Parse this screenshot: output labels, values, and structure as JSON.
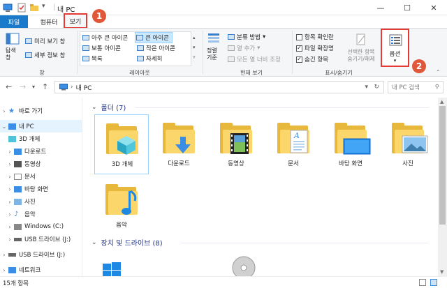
{
  "titlebar": {
    "title": "내 PC",
    "minimize": "—",
    "maximize": "☐",
    "close": "✕"
  },
  "tabs": {
    "file": "파일",
    "computer": "컴퓨터",
    "view": "보기"
  },
  "annotations": {
    "badge1": "1",
    "badge2": "2"
  },
  "ribbon": {
    "pane": {
      "nav_pane_label": "탐색\n창",
      "preview": "미리 보기 창",
      "details": "세부 정보 창",
      "group": "창"
    },
    "layout": {
      "xlarge": "아주 큰 아이콘",
      "large": "큰 아이콘",
      "medium": "보통 아이콘",
      "small": "작은 아이콘",
      "list": "목록",
      "details": "자세히",
      "group": "레이아웃"
    },
    "current_view": {
      "sort_label": "정렬\n기준",
      "group_by": "분류 방법",
      "add_columns": "열 추가",
      "fit_columns": "모든 열 너비 조정",
      "group": "현재 보기"
    },
    "show_hide": {
      "item_checkboxes": "항목 확인란",
      "file_extensions": "파일 확장명",
      "hidden_items": "숨긴 항목",
      "hide_selected": "선택한 항목\n숨기기/해제",
      "options": "옵션",
      "group": "표시/숨기기"
    }
  },
  "address": {
    "path": "내 PC",
    "search_placeholder": "내 PC 검색"
  },
  "navpane": {
    "items": [
      {
        "label": "바로 가기"
      },
      {
        "label": "내 PC"
      },
      {
        "label": "3D 개체"
      },
      {
        "label": "다운로드"
      },
      {
        "label": "동영상"
      },
      {
        "label": "문서"
      },
      {
        "label": "바탕 화면"
      },
      {
        "label": "사진"
      },
      {
        "label": "음악"
      },
      {
        "label": "Windows (C:)"
      },
      {
        "label": "USB 드라이브 (J:)"
      },
      {
        "label": "USB 드라이브 (J:)"
      },
      {
        "label": "네트워크"
      }
    ]
  },
  "content": {
    "folders_header": "폴더 (7)",
    "folders": [
      {
        "label": "3D 개체"
      },
      {
        "label": "다운로드"
      },
      {
        "label": "동영상"
      },
      {
        "label": "문서"
      },
      {
        "label": "바탕 화면"
      },
      {
        "label": "사진"
      },
      {
        "label": "음악"
      }
    ],
    "drives_header": "장치 및 드라이브 (8)"
  },
  "status": {
    "count": "15개 항목"
  },
  "colors": {
    "accent": "#1979ca",
    "folder": "#fad66b",
    "highlight": "#e53935"
  }
}
